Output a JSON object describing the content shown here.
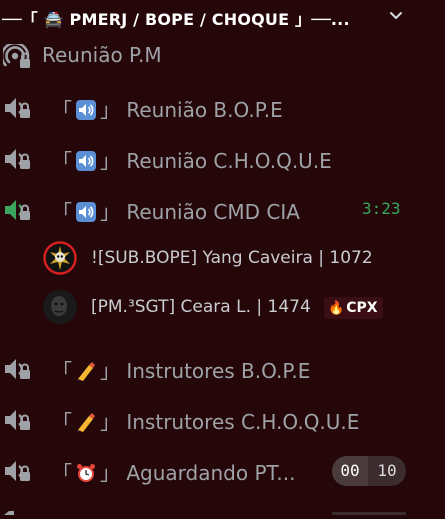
{
  "header": {
    "title": "──「 🚔 PMERJ / BOPE / CHOQUE 」──..."
  },
  "channels": [
    {
      "label": "Reunião P.M",
      "type": "stage"
    },
    {
      "prefix": "「",
      "emoji": "🔊",
      "suffix": "」",
      "name": "Reunião B.O.P.E",
      "type": "voice-locked"
    },
    {
      "prefix": "「",
      "emoji": "🔊",
      "suffix": "」",
      "name": "Reunião C.H.O.Q.U.E",
      "type": "voice-locked"
    },
    {
      "prefix": "「",
      "emoji": "🔊",
      "suffix": "」",
      "name": "Reunião CMD CIA",
      "type": "voice-active",
      "timer": "3:23"
    },
    {
      "prefix": "「",
      "emoji": "✍️",
      "suffix": "」",
      "name": "Instrutores B.O.P.E",
      "type": "voice-locked"
    },
    {
      "prefix": "「",
      "emoji": "✍️",
      "suffix": "」",
      "name": "Instrutores C.H.O.Q.U.E",
      "type": "voice-locked"
    },
    {
      "prefix": "「",
      "emoji": "⏰",
      "suffix": "」",
      "name": "Aguardando PT...",
      "type": "voice-locked",
      "user_count": "00",
      "user_limit": "10"
    }
  ],
  "voice_users": [
    {
      "name": "![SUB.BOPE] Yang Caveira | 1072"
    },
    {
      "name": "[PM.³SGT] Ceara L. | 1474",
      "badge_emoji": "🔥",
      "badge_text": "CPX"
    }
  ],
  "colors": {
    "background": "#250709",
    "active_green": "#3ba55d",
    "muted": "#9ea2a7"
  }
}
